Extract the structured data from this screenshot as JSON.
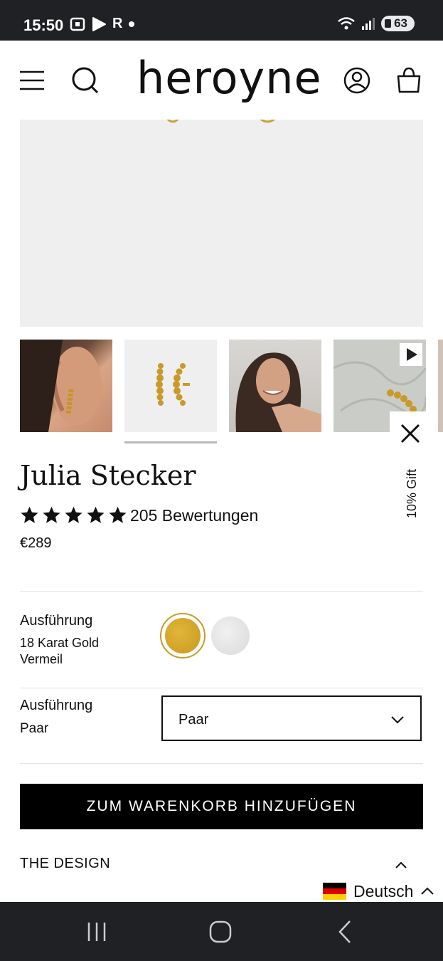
{
  "status_bar": {
    "time": "15:50",
    "carrier_icon_label": "R",
    "battery": "63",
    "icons": [
      "screenshot-icon",
      "play-icon",
      "wifi-icon",
      "signal-icon",
      "battery-icon"
    ]
  },
  "header": {
    "logo": "heroyne",
    "icons": [
      "menu-icon",
      "search-icon",
      "account-icon",
      "cart-icon"
    ]
  },
  "gallery": {
    "thumbnails": [
      "ear-model-photo",
      "earrings-product-photo",
      "smiling-model-photo",
      "earring-video-thumbnail"
    ],
    "video_icon": "play-icon"
  },
  "gift_tab": {
    "label": "10% Gift",
    "close_icon": "close-icon"
  },
  "product": {
    "title": "Julia Stecker",
    "rating": 5,
    "reviews": "205 Bewertungen",
    "price": "€289"
  },
  "option_finish": {
    "label": "Ausführung",
    "value": "18 Karat Gold Vermeil",
    "swatches": [
      {
        "name": "gold",
        "color": "#d4a62a",
        "selected": true
      },
      {
        "name": "silver",
        "color": "#e4e4e4",
        "selected": false
      }
    ]
  },
  "option_variant": {
    "label": "Ausführung",
    "value": "Paar",
    "select_value": "Paar"
  },
  "cta": {
    "label": "ZUM WARENKORB HINZUFÜGEN"
  },
  "design_section": {
    "title": "THE DESIGN"
  },
  "language": {
    "label": "Deutsch",
    "flag_colors": [
      "#000000",
      "#dd0000",
      "#ffce00"
    ]
  },
  "nav_bar": {
    "items": [
      "recent-apps-icon",
      "home-icon",
      "back-icon"
    ]
  }
}
